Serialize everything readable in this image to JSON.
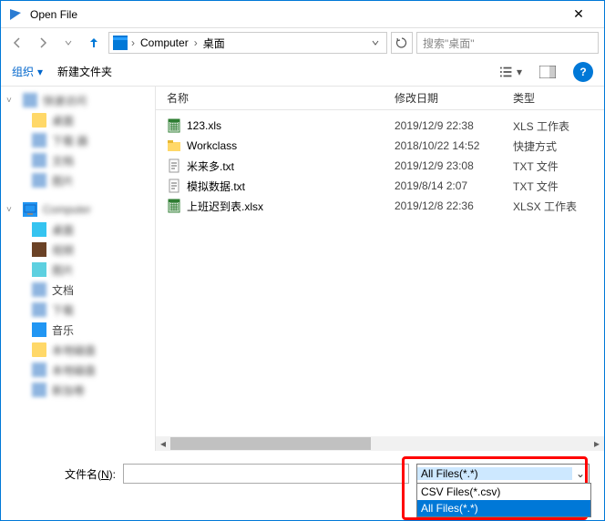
{
  "title": "Open File",
  "breadcrumb": {
    "item1": "Computer",
    "item2": "桌面"
  },
  "search": {
    "placeholder": "搜索\"桌面\""
  },
  "toolbar": {
    "organize": "组织",
    "newfolder": "新建文件夹"
  },
  "columns": {
    "name": "名称",
    "date": "修改日期",
    "type": "类型"
  },
  "sidebar": {
    "i0": "快速访问",
    "i1": "桌面",
    "i2": "下载    器",
    "i3": "文档",
    "i4": "图片",
    "computer": "Computer",
    "s0": "桌面",
    "s1": "视频",
    "s2": "图片",
    "s3": "文档",
    "s4": "下载",
    "s5": "音乐",
    "s6": "本地磁盘",
    "s7": "本地磁盘",
    "s8": "新加卷"
  },
  "files": [
    {
      "name": "123.xls",
      "date": "2019/12/9 22:38",
      "type": "XLS 工作表",
      "icon": "xls"
    },
    {
      "name": "Workclass",
      "date": "2018/10/22 14:52",
      "type": "快捷方式",
      "icon": "folder"
    },
    {
      "name": "米来多.txt",
      "date": "2019/12/9 23:08",
      "type": "TXT 文件",
      "icon": "txt"
    },
    {
      "name": "模拟数据.txt",
      "date": "2019/8/14 2:07",
      "type": "TXT 文件",
      "icon": "txt"
    },
    {
      "name": "上班迟到表.xlsx",
      "date": "2019/12/8 22:36",
      "type": "XLSX 工作表",
      "icon": "xls"
    }
  ],
  "filename": {
    "label_pre": "文件名(",
    "label_key": "N",
    "label_post": "):"
  },
  "filetype": {
    "selected": "All Files(*.*)",
    "opt0": "CSV Files(*.csv)",
    "opt1": "All Files(*.*)"
  }
}
